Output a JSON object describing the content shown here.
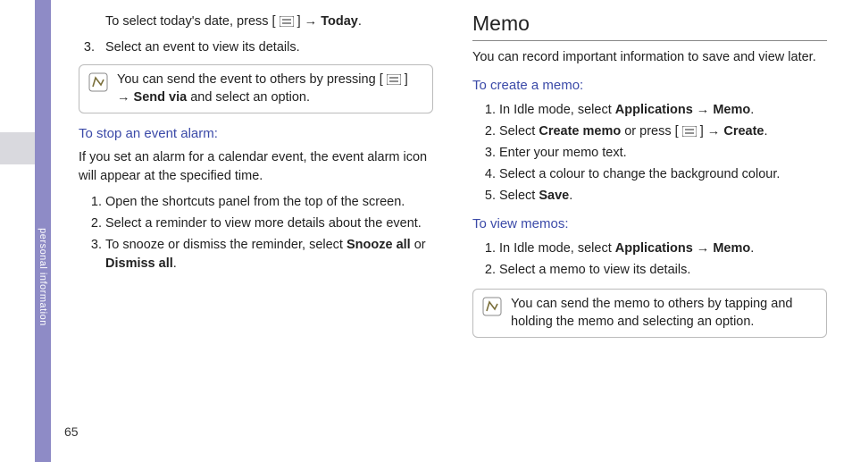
{
  "tab_label": "personal information",
  "page_number": "65",
  "left": {
    "line_top_pre": "To select today's date, press [ ",
    "line_top_mid": " ] → ",
    "line_top_bold": "Today",
    "line_top_post": ".",
    "step3_pre": "3.",
    "step3": "Select an event to view its details.",
    "note1_pre": "You can send the event to others by pressing [ ",
    "note1_mid": " ] → ",
    "note1_bold": "Send via",
    "note1_post": " and select an option.",
    "sub1": "To stop an event alarm:",
    "para1": "If you set an alarm for a calendar event, the event alarm icon will appear at the specified time.",
    "ol2_1": "Open the shortcuts panel from the top of the screen.",
    "ol2_2": "Select a reminder to view more details about the event.",
    "ol2_3_pre": "To snooze or dismiss the reminder, select ",
    "ol2_3_b1": "Snooze all",
    "ol2_3_mid": " or ",
    "ol2_3_b2": "Dismiss all",
    "ol2_3_post": "."
  },
  "right": {
    "h2": "Memo",
    "intro": "You can record important information to save and view later.",
    "sub1": "To create a memo:",
    "ol1_1_pre": "In Idle mode, select ",
    "ol1_1_b1": "Applications",
    "ol1_1_mid": " → ",
    "ol1_1_b2": "Memo",
    "ol1_1_post": ".",
    "ol1_2_pre": "Select ",
    "ol1_2_b1": "Create memo",
    "ol1_2_mid": " or press [ ",
    "ol1_2_mid2": " ] → ",
    "ol1_2_b2": "Create",
    "ol1_2_post": ".",
    "ol1_3": "Enter your memo text.",
    "ol1_4": "Select a colour to change the background colour.",
    "ol1_5_pre": "Select ",
    "ol1_5_b": "Save",
    "ol1_5_post": ".",
    "sub2": "To view memos:",
    "ol2_1_pre": "In Idle mode, select ",
    "ol2_1_b1": "Applications",
    "ol2_1_mid": " → ",
    "ol2_1_b2": "Memo",
    "ol2_1_post": ".",
    "ol2_2": "Select a memo to view its details.",
    "note_text": "You can send the memo to others by tapping and holding the memo and selecting an option."
  }
}
